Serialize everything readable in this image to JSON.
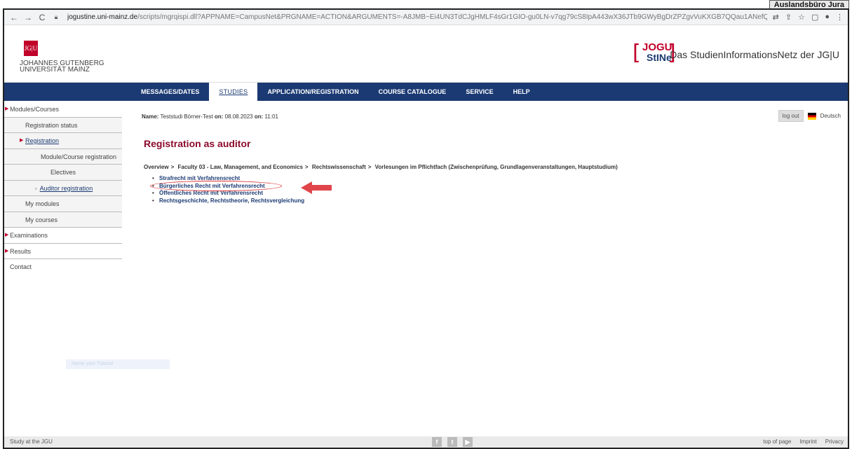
{
  "corner_tag": "Auslandsbüro Jura",
  "browser": {
    "url_domain": "jogustine.uni-mainz.de",
    "url_path": "/scripts/mgrqispi.dll?APPNAME=CampusNet&PRGNAME=ACTION&ARGUMENTS=-A8JMB~Ei4UN3TdCJgHMLF4sGr1GIO-gu0LN-v7qg79cS8IpA443wX36JTb9GWyBgDrZPZgvVuKXGB7QQau1ANefQ88AVw6mrxoyERRWkHpjgBIWxC..."
  },
  "header": {
    "jgu_logo": "JG|U",
    "jgu_line1": "JOHANNES GUTENBERG",
    "jgu_line2": "UNIVERSITÄT MAINZ",
    "jogu_word": "JOGU",
    "stine_word": "StINe",
    "tagline": "Das StudienInformationsNetz der JG|U"
  },
  "nav": {
    "messages": "MESSAGES/DATES",
    "studies": "STUDIES",
    "application": "APPLICATION/REGISTRATION",
    "catalogue": "COURSE CATALOGUE",
    "service": "SERVICE",
    "help": "HELP"
  },
  "sidebar": {
    "modules_courses": "Modules/Courses",
    "registration_status": "Registration status",
    "registration": "Registration",
    "module_course_registration": "Module/Course registration",
    "electives": "Electives",
    "auditor_registration": "Auditor registration",
    "my_modules": "My modules",
    "my_courses": "My courses",
    "examinations": "Examinations",
    "results": "Results",
    "contact": "Contact",
    "ghost": "Name your Tutorial"
  },
  "main": {
    "name_label": "Name:",
    "name_value": "Teststudi Börner-Test",
    "on_label1": "on:",
    "date": "08.08.2023",
    "on_label2": "on:",
    "time": "11:01",
    "logout": "log out",
    "language": "Deutsch",
    "title": "Registration as auditor",
    "breadcrumb": [
      "Overview",
      "Faculty 03 - Law, Management, and Economics",
      "Rechtswissenschaft",
      "Vorlesungen im Pflichtfach (Zwischenprüfung, Grundlagenveranstaltungen, Hauptstudium)"
    ],
    "courses": [
      "Strafrecht mit Verfahrensrecht",
      "Bürgerliches Recht mit Verfahrensrecht",
      "Öffentliches Recht mit Verfahrensrecht",
      "Rechtsgeschichte, Rechtstheorie, Rechtsvergleichung"
    ]
  },
  "footer": {
    "study": "Study at the JGU",
    "top": "top of page",
    "imprint": "Imprint",
    "privacy": "Privacy"
  },
  "colors": {
    "brand_red": "#c1002a",
    "nav_blue": "#1b3a73",
    "title_red": "#8b0a2a"
  }
}
